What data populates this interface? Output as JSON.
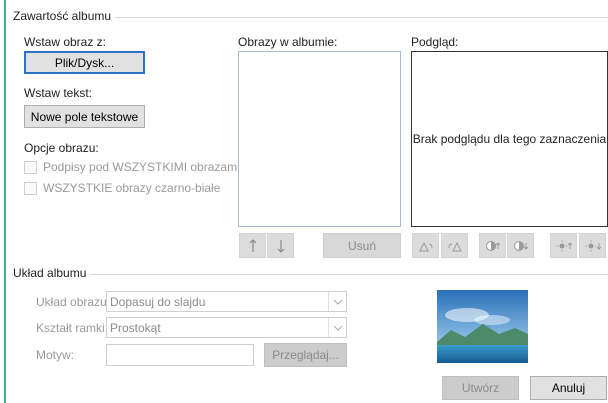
{
  "album_content": {
    "title": "Zawartość albumu",
    "insert_image_from": "Wstaw obraz z:",
    "file_disk_button": "Plik/Dysk...",
    "insert_text": "Wstaw tekst:",
    "new_textbox_button": "Nowe pole tekstowe",
    "image_options": "Opcje obrazu:",
    "captions_checkbox": "Podpisy pod WSZYSTKIMI obrazami",
    "bw_checkbox": "WSZYSTKIE obrazy czarno-białe",
    "images_in_album": "Obrazy w albumie:",
    "remove_button": "Usuń",
    "preview_label": "Podgląd:",
    "preview_empty": "Brak podglądu dla tego zaznaczenia"
  },
  "album_layout": {
    "title": "Układ albumu",
    "layout_label": "Układ obrazu:",
    "layout_value": "Dopasuj do slajdu",
    "frame_label": "Kształt ramki:",
    "frame_value": "Prostokąt",
    "theme_label": "Motyw:",
    "theme_value": "",
    "browse_button": "Przeglądaj..."
  },
  "footer": {
    "create_button": "Utwórz",
    "cancel_button": "Anuluj"
  },
  "colors": {
    "accent": "#3fb27f",
    "listbox_border": "#a9bcd6",
    "focus_border": "#2d72c4"
  }
}
